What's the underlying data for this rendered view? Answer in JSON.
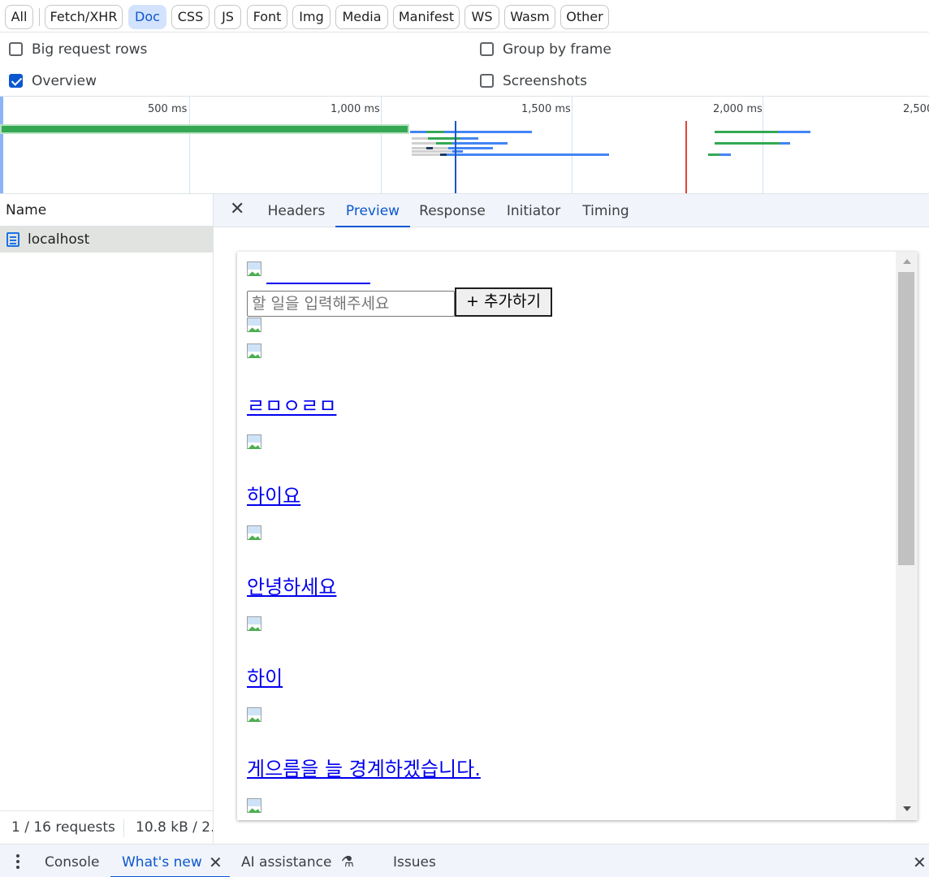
{
  "filters": [
    "All",
    "Fetch/XHR",
    "Doc",
    "CSS",
    "JS",
    "Font",
    "Img",
    "Media",
    "Manifest",
    "WS",
    "Wasm",
    "Other"
  ],
  "active_filter": "Doc",
  "options": {
    "big_request_rows": {
      "label": "Big request rows",
      "checked": false
    },
    "group_by_frame": {
      "label": "Group by frame",
      "checked": false
    },
    "overview": {
      "label": "Overview",
      "checked": true
    },
    "screenshots": {
      "label": "Screenshots",
      "checked": false
    }
  },
  "overview": {
    "ticks": [
      "500 ms",
      "1,000 ms",
      "1,500 ms",
      "2,000 ms",
      "2,500"
    ]
  },
  "requests": {
    "header": "Name",
    "rows": [
      {
        "name": "localhost",
        "icon": "document-icon"
      }
    ],
    "status_count": "1 / 16 requests",
    "status_size": "10.8 kB / 2."
  },
  "detail_tabs": [
    "Headers",
    "Preview",
    "Response",
    "Initiator",
    "Timing"
  ],
  "active_detail_tab": "Preview",
  "preview": {
    "input_placeholder": "할 일을 입력해주세요",
    "add_button": "+ 추가하기",
    "items": [
      "ㄹㅁㅇㄹㅁ",
      "하이요",
      "안녕하세요",
      "하이",
      "게으름을 늘 경계하겠습니다."
    ]
  },
  "drawer": {
    "tabs": [
      "Console",
      "What's new",
      "AI assistance",
      "Issues"
    ],
    "active": "What's new"
  },
  "colors": {
    "accent": "#0b57d0",
    "link": "#0000ee",
    "green": "#34a853",
    "blue": "#4285f4",
    "red": "#ea4335"
  }
}
